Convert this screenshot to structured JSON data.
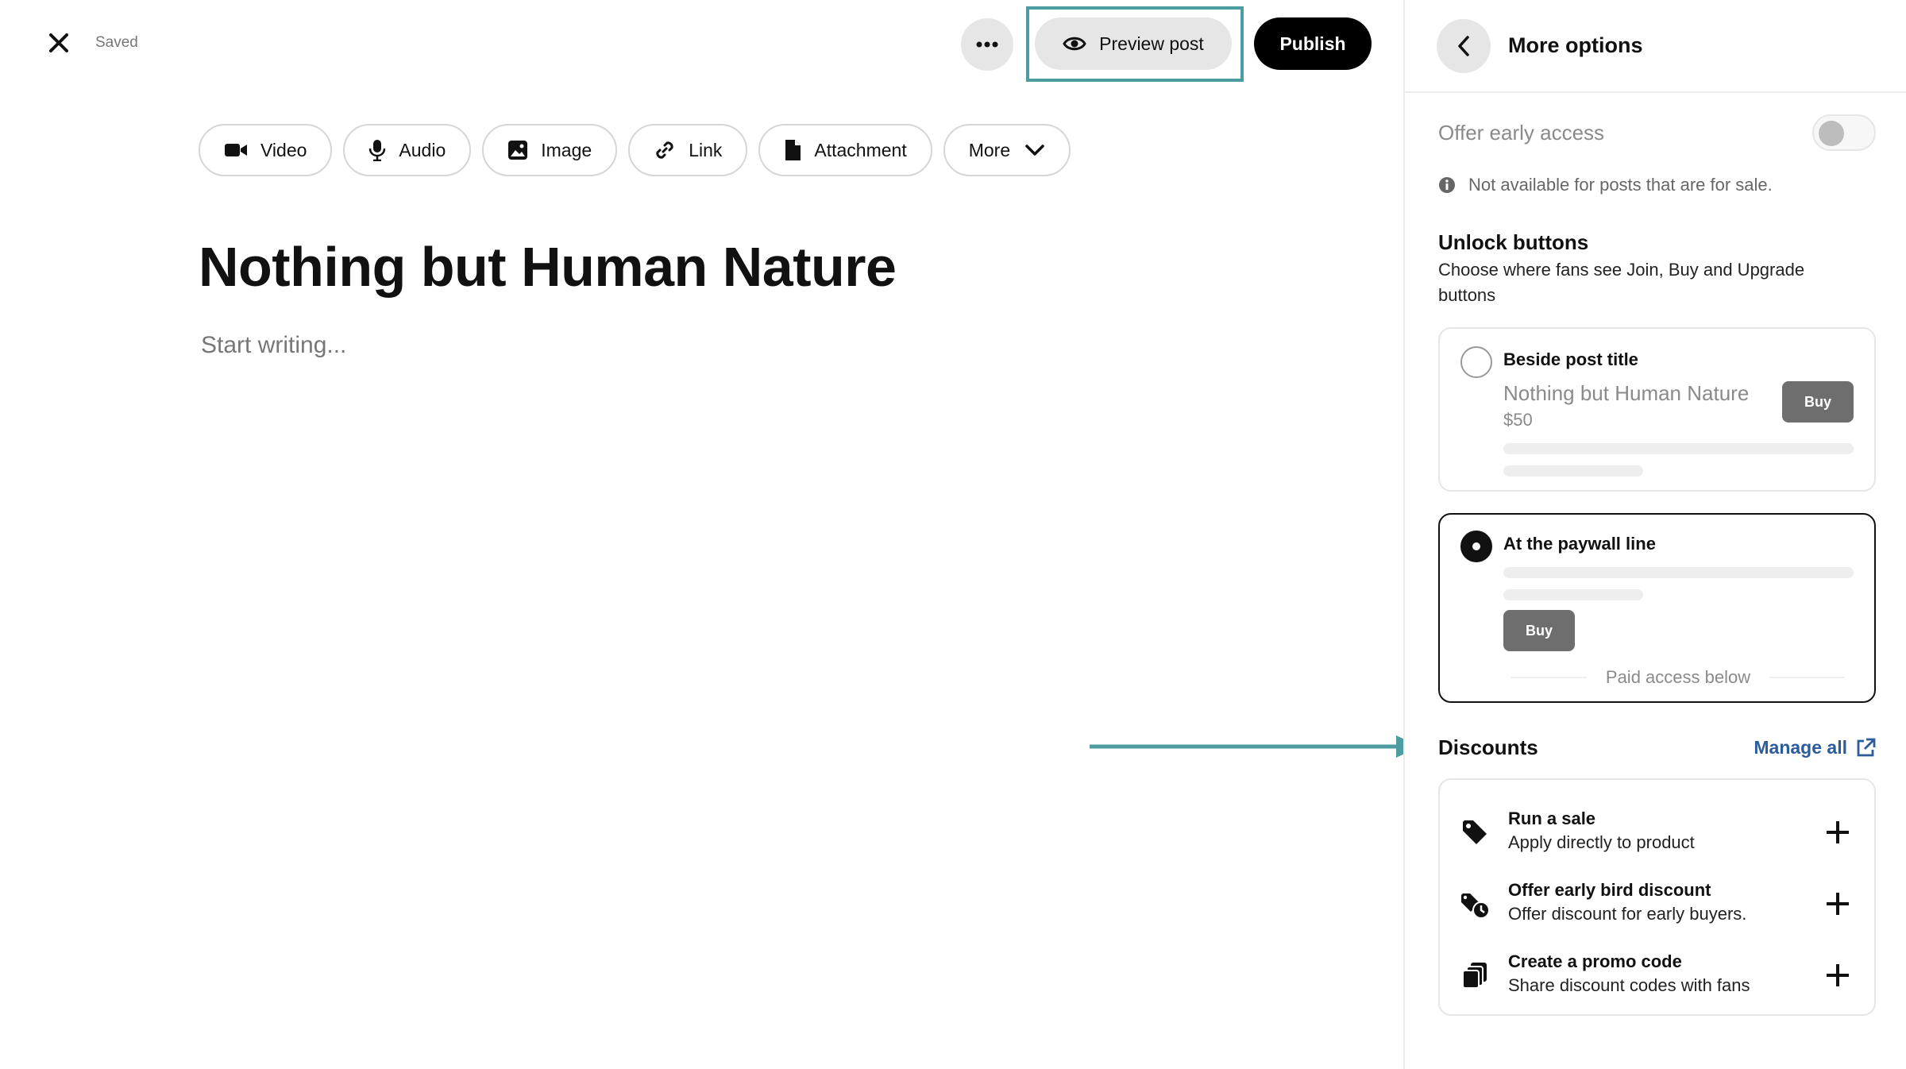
{
  "topbar": {
    "saved_label": "Saved",
    "preview_label": "Preview post",
    "publish_label": "Publish"
  },
  "media_buttons": {
    "video": "Video",
    "audio": "Audio",
    "image": "Image",
    "link": "Link",
    "attachment": "Attachment",
    "more": "More"
  },
  "post": {
    "title": "Nothing but Human Nature",
    "body_placeholder": "Start writing..."
  },
  "panel": {
    "title": "More options",
    "early_access_label": "Offer early access",
    "early_access_enabled": false,
    "early_access_note": "Not available for posts that are for sale.",
    "unlock_title": "Unlock buttons",
    "unlock_desc": "Choose where fans see Join, Buy and Upgrade buttons",
    "option_beside": {
      "label": "Beside post title",
      "selected": false,
      "preview_title": "Nothing but Human Nature",
      "preview_price": "$50",
      "buy_label": "Buy"
    },
    "option_paywall": {
      "label": "At the paywall line",
      "selected": true,
      "buy_label": "Buy",
      "paid_access_label": "Paid access below"
    },
    "discounts": {
      "title": "Discounts",
      "manage_label": "Manage all",
      "items": [
        {
          "name": "Run a sale",
          "sub": "Apply directly to product",
          "icon": "tag-icon"
        },
        {
          "name": "Offer early bird discount",
          "sub": "Offer discount for early buyers.",
          "icon": "early-bird-icon"
        },
        {
          "name": "Create a promo code",
          "sub": "Share discount codes with fans",
          "icon": "promo-code-icon"
        }
      ]
    }
  },
  "colors": {
    "highlight": "#4d9ca1",
    "link": "#2c5d9a",
    "publish_bg": "#000000"
  }
}
